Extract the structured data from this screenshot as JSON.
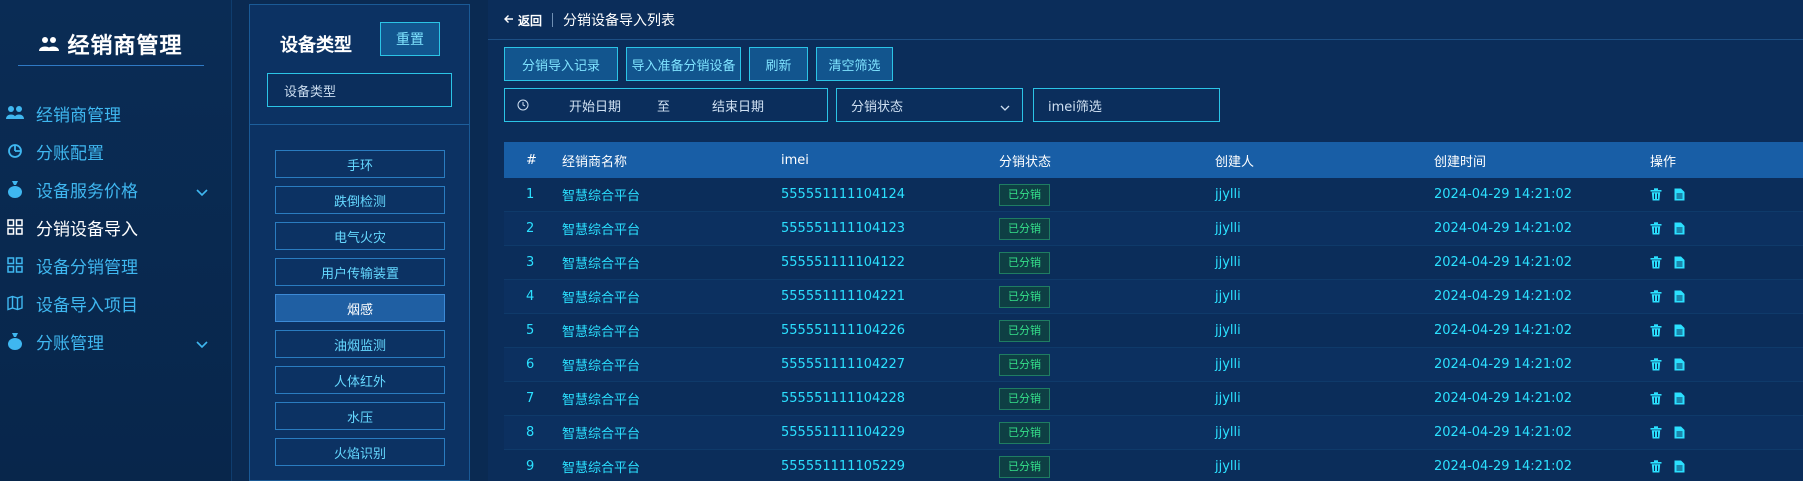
{
  "sidebar": {
    "brand_title": "经销商管理",
    "items": [
      {
        "label": "经销商管理",
        "icon": "users-icon",
        "active": false,
        "expandable": false
      },
      {
        "label": "分账配置",
        "icon": "pie-chart-icon",
        "active": false,
        "expandable": false
      },
      {
        "label": "设备服务价格",
        "icon": "money-bag-icon",
        "active": false,
        "expandable": true
      },
      {
        "label": "分销设备导入",
        "icon": "grid-icon",
        "active": true,
        "expandable": false
      },
      {
        "label": "设备分销管理",
        "icon": "grid-icon",
        "active": false,
        "expandable": false
      },
      {
        "label": "设备导入项目",
        "icon": "map-icon",
        "active": false,
        "expandable": false
      },
      {
        "label": "分账管理",
        "icon": "money-bag-icon",
        "active": false,
        "expandable": true
      }
    ]
  },
  "type_panel": {
    "title": "设备类型",
    "reset_label": "重置",
    "input_placeholder": "设备类型",
    "items": [
      "手环",
      "跌倒检测",
      "电气火灾",
      "用户传输装置",
      "烟感",
      "油烟监测",
      "人体红外",
      "水压",
      "火焰识别"
    ],
    "active_index": 4
  },
  "header": {
    "back_label": "返回",
    "page_title": "分销设备导入列表"
  },
  "toolbar": {
    "import_record_label": "分销导入记录",
    "import_prepare_label": "导入准备分销设备",
    "refresh_label": "刷新",
    "clear_label": "清空筛选"
  },
  "filters": {
    "start_date_placeholder": "开始日期",
    "range_sep": "至",
    "end_date_placeholder": "结束日期",
    "status_placeholder": "分销状态",
    "imei_placeholder": "imei筛选"
  },
  "table": {
    "columns": [
      "#",
      "经销商名称",
      "imei",
      "分销状态",
      "创建人",
      "创建时间",
      "操作"
    ],
    "rows": [
      {
        "idx": "1",
        "name": "智慧综合平台",
        "imei": "555551111104124",
        "status": "已分销",
        "creator": "jjylli",
        "time": "2024-04-29 14:21:02"
      },
      {
        "idx": "2",
        "name": "智慧综合平台",
        "imei": "555551111104123",
        "status": "已分销",
        "creator": "jjylli",
        "time": "2024-04-29 14:21:02"
      },
      {
        "idx": "3",
        "name": "智慧综合平台",
        "imei": "555551111104122",
        "status": "已分销",
        "creator": "jjylli",
        "time": "2024-04-29 14:21:02"
      },
      {
        "idx": "4",
        "name": "智慧综合平台",
        "imei": "555551111104221",
        "status": "已分销",
        "creator": "jjylli",
        "time": "2024-04-29 14:21:02"
      },
      {
        "idx": "5",
        "name": "智慧综合平台",
        "imei": "555551111104226",
        "status": "已分销",
        "creator": "jjylli",
        "time": "2024-04-29 14:21:02"
      },
      {
        "idx": "6",
        "name": "智慧综合平台",
        "imei": "555551111104227",
        "status": "已分销",
        "creator": "jjylli",
        "time": "2024-04-29 14:21:02"
      },
      {
        "idx": "7",
        "name": "智慧综合平台",
        "imei": "555551111104228",
        "status": "已分销",
        "creator": "jjylli",
        "time": "2024-04-29 14:21:02"
      },
      {
        "idx": "8",
        "name": "智慧综合平台",
        "imei": "555551111104229",
        "status": "已分销",
        "creator": "jjylli",
        "time": "2024-04-29 14:21:02"
      },
      {
        "idx": "9",
        "name": "智慧综合平台",
        "imei": "555551111105229",
        "status": "已分销",
        "creator": "jjylli",
        "time": "2024-04-29 14:21:02"
      }
    ],
    "row_actions": [
      "delete-icon",
      "document-icon"
    ]
  },
  "colors": {
    "accent_cyan": "#2bc4e6",
    "status_green": "#35e08a",
    "header_blue": "#185ea6"
  }
}
